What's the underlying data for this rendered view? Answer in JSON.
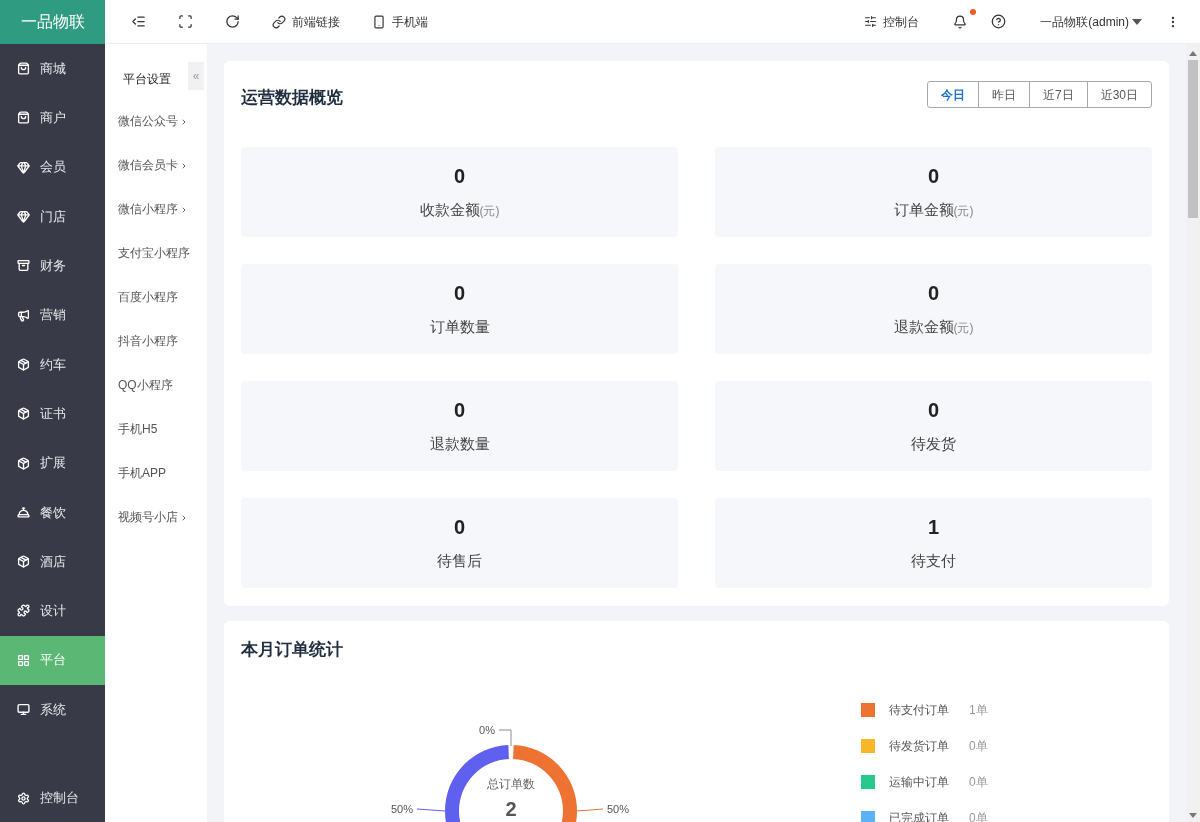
{
  "brand": "一品物联",
  "toolbar": [
    {
      "kind": "fold"
    },
    {
      "kind": "fullscreen"
    },
    {
      "kind": "refresh"
    },
    {
      "kind": "link",
      "label": "前端链接"
    },
    {
      "kind": "mobile",
      "label": "手机端"
    }
  ],
  "topright": {
    "console": "控制台",
    "notification_dot": true,
    "user": "一品物联(admin)"
  },
  "sidebar": {
    "items": [
      {
        "label": "商城",
        "kind": "bag",
        "selected": false
      },
      {
        "label": "商户",
        "kind": "bag",
        "selected": false
      },
      {
        "label": "会员",
        "kind": "gem",
        "selected": false
      },
      {
        "label": "门店",
        "kind": "gem",
        "selected": false
      },
      {
        "label": "财务",
        "kind": "archive",
        "selected": false
      },
      {
        "label": "营销",
        "kind": "megaphone",
        "selected": false
      },
      {
        "label": "约车",
        "kind": "box",
        "selected": false
      },
      {
        "label": "证书",
        "kind": "box",
        "selected": false
      },
      {
        "label": "扩展",
        "kind": "box",
        "selected": false
      },
      {
        "label": "餐饮",
        "kind": "cloche",
        "selected": false
      },
      {
        "label": "酒店",
        "kind": "box",
        "selected": false
      },
      {
        "label": "设计",
        "kind": "puzzle",
        "selected": false
      },
      {
        "label": "平台",
        "kind": "grid",
        "selected": true
      },
      {
        "label": "系统",
        "kind": "monitor",
        "selected": false
      }
    ],
    "footer": "控制台"
  },
  "submenu": {
    "title": "平台设置",
    "collapse": "«",
    "items": [
      {
        "label": "微信公众号",
        "has_children": true
      },
      {
        "label": "微信会员卡",
        "has_children": true
      },
      {
        "label": "微信小程序",
        "has_children": true
      },
      {
        "label": "支付宝小程序",
        "has_children": false
      },
      {
        "label": "百度小程序",
        "has_children": false
      },
      {
        "label": "抖音小程序",
        "has_children": false
      },
      {
        "label": "QQ小程序",
        "has_children": false
      },
      {
        "label": "手机H5",
        "has_children": false
      },
      {
        "label": "手机APP",
        "has_children": false
      },
      {
        "label": "视频号小店",
        "has_children": true
      }
    ]
  },
  "overview": {
    "title": "运营数据概览",
    "ranges": [
      {
        "label": "今日",
        "selected": true
      },
      {
        "label": "昨日",
        "selected": false
      },
      {
        "label": "近7日",
        "selected": false
      },
      {
        "label": "近30日",
        "selected": false
      }
    ],
    "stats": [
      {
        "value": "0",
        "label": "收款金额",
        "unit": "(元)"
      },
      {
        "value": "0",
        "label": "订单金额",
        "unit": "(元)"
      },
      {
        "value": "0",
        "label": "订单数量"
      },
      {
        "value": "0",
        "label": "退款金额",
        "unit": "(元)"
      },
      {
        "value": "0",
        "label": "退款数量"
      },
      {
        "value": "0",
        "label": "待发货"
      },
      {
        "value": "0",
        "label": "待售后"
      },
      {
        "value": "1",
        "label": "待支付"
      }
    ]
  },
  "monthly": {
    "title": "本月订单统计",
    "chart_data": {
      "type": "donut",
      "values": [
        0.5,
        0.5,
        0
      ],
      "colors": [
        "#ee7333",
        "#6060f0",
        "#8a8a99"
      ],
      "value_labels": [
        "50%",
        "50%",
        "0%"
      ]
    },
    "center_label": "总订单数",
    "total": "2",
    "legend": [
      {
        "label": "待支付订单",
        "count": "1单",
        "color": "#ee7333"
      },
      {
        "label": "待发货订单",
        "count": "0单",
        "color": "#f8b72a"
      },
      {
        "label": "运输中订单",
        "count": "0单",
        "color": "#27c98d"
      },
      {
        "label": "已完成订单",
        "count": "0单",
        "color": "#5ab1f6"
      }
    ]
  }
}
